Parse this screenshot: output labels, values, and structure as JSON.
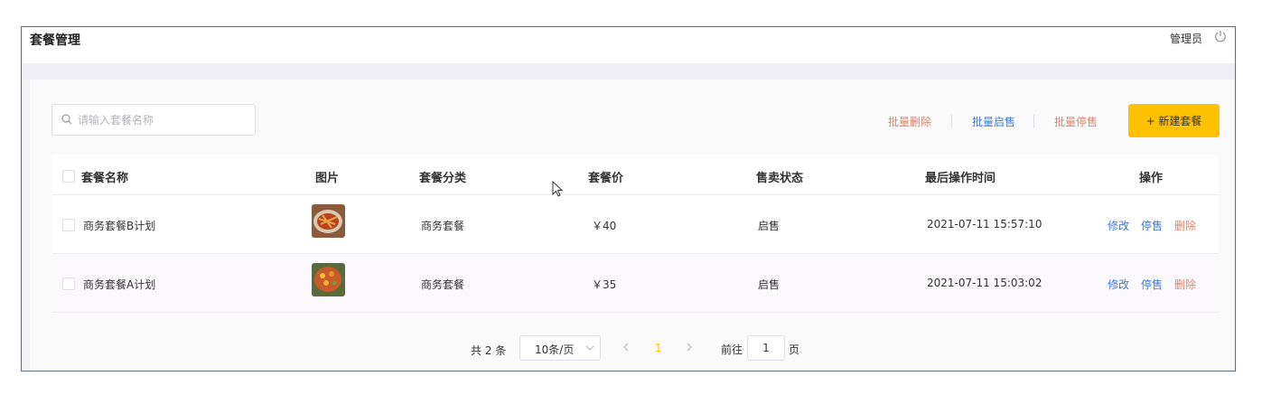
{
  "header": {
    "title": "套餐管理",
    "user": "管理员"
  },
  "toolbar": {
    "search_placeholder": "请输入套餐名称",
    "batch_delete": "批量删除",
    "batch_on": "批量启售",
    "batch_off": "批量停售",
    "new_button": "+ 新建套餐"
  },
  "table": {
    "columns": [
      "套餐名称",
      "图片",
      "套餐分类",
      "套餐价",
      "售卖状态",
      "最后操作时间",
      "操作"
    ],
    "rows": [
      {
        "name": "商务套餐B计划",
        "category": "商务套餐",
        "price": "￥40",
        "status": "启售",
        "time": "2021-07-11 15:57:10",
        "edit": "修改",
        "toggle": "停售",
        "delete": "删除"
      },
      {
        "name": "商务套餐A计划",
        "category": "商务套餐",
        "price": "￥35",
        "status": "启售",
        "time": "2021-07-11 15:03:02",
        "edit": "修改",
        "toggle": "停售",
        "delete": "删除"
      }
    ]
  },
  "pagination": {
    "total_text": "共 2 条",
    "page_size": "10条/页",
    "current_page": "1",
    "goto_label": "前往",
    "goto_value": "1",
    "page_unit": "页"
  },
  "colors": {
    "accent": "#ffc200",
    "link": "#3d7bdc",
    "danger": "#e0826d"
  }
}
